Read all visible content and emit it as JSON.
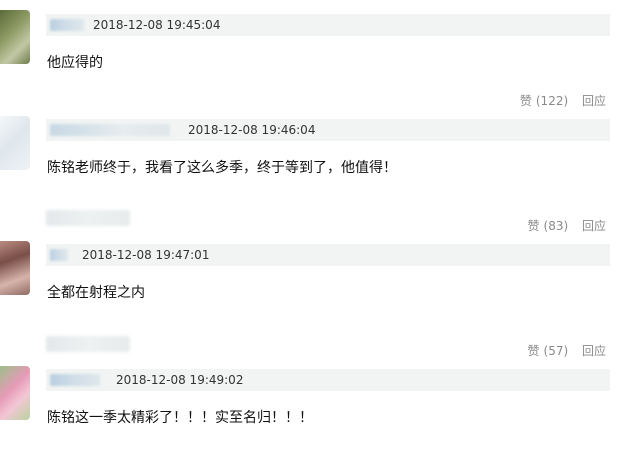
{
  "comments": [
    {
      "timestamp": "2018-12-08 19:45:04",
      "text": "他应得的",
      "like_label": "赞",
      "like_count": "(122)",
      "reply_label": "回应",
      "avatar_colors": [
        "#5b6a3a",
        "#9aa37a"
      ]
    },
    {
      "timestamp": "2018-12-08 19:46:04",
      "text": "陈铭老师终于，我看了这么多季，终于等到了，他值得！",
      "like_label": "赞",
      "like_count": "(83)",
      "reply_label": "回应",
      "avatar_colors": [
        "#e6eef3",
        "#cfd9e0"
      ]
    },
    {
      "timestamp": "2018-12-08 19:47:01",
      "text": "全都在射程之内",
      "like_label": "赞",
      "like_count": "(57)",
      "reply_label": "回应",
      "avatar_colors": [
        "#7a4f48",
        "#c9a39a"
      ]
    },
    {
      "timestamp": "2018-12-08 19:49:02",
      "text": "陈铭这一季太精彩了！！！实至名归！！！",
      "avatar_colors": [
        "#e59ab6",
        "#9bc08a"
      ]
    }
  ]
}
